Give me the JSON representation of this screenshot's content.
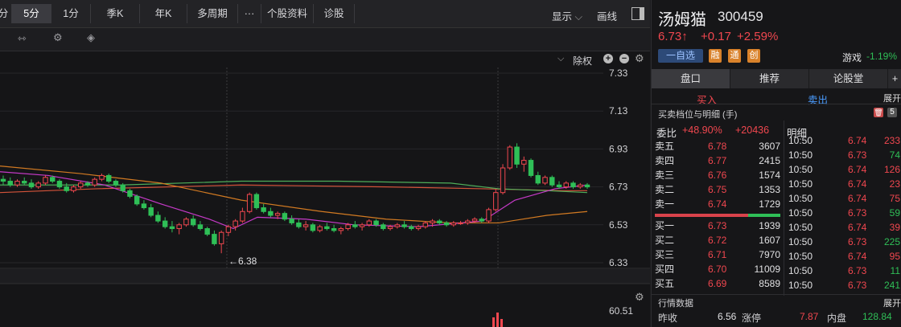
{
  "period_tabs": [
    "分",
    "5分",
    "1分",
    "季K",
    "年K",
    "多周期",
    "···",
    "个股资料",
    "诊股"
  ],
  "active_tab_index": 1,
  "display_label": "显示",
  "draw_label": "画线",
  "chart_header": {
    "adjust_label": "除权"
  },
  "price_axis": [
    "7.33",
    "7.13",
    "6.93",
    "6.73",
    "6.53",
    "6.33"
  ],
  "volume_axis_top": "60.51",
  "min_marker": "←6.38",
  "stock": {
    "name": "汤姆猫",
    "code": "300459",
    "price": "6.73↑",
    "change": "+0.17",
    "change_pct": "+2.59%",
    "watch_label": "一自选",
    "badges": [
      "融",
      "通",
      "创"
    ],
    "sector": "游戏",
    "sector_change": "-1.19%"
  },
  "right_tabs": [
    "盘口",
    "推荐",
    "论股堂",
    "+"
  ],
  "buy_label": "买入",
  "sell_label": "卖出",
  "expand_label": "展开",
  "orderbook_title": "买卖档位与明细 (手)",
  "orderbook_icon_label": "5",
  "weibi": {
    "label": "委比",
    "pct": "+48.90%",
    "value": "+20436"
  },
  "detail_label": "明细",
  "asks": [
    {
      "label": "卖五",
      "price": "6.78",
      "vol": "3607"
    },
    {
      "label": "卖四",
      "price": "6.77",
      "vol": "2415"
    },
    {
      "label": "卖三",
      "price": "6.76",
      "vol": "1574"
    },
    {
      "label": "卖二",
      "price": "6.75",
      "vol": "1353"
    },
    {
      "label": "卖一",
      "price": "6.74",
      "vol": "1729"
    }
  ],
  "bids": [
    {
      "label": "买一",
      "price": "6.73",
      "vol": "1939"
    },
    {
      "label": "买二",
      "price": "6.72",
      "vol": "1607"
    },
    {
      "label": "买三",
      "price": "6.71",
      "vol": "7970"
    },
    {
      "label": "买四",
      "price": "6.70",
      "vol": "11009"
    },
    {
      "label": "买五",
      "price": "6.69",
      "vol": "8589"
    }
  ],
  "ticks": [
    {
      "time": "10:50",
      "price": "6.74",
      "vol": "233",
      "dir": "up"
    },
    {
      "time": "10:50",
      "price": "6.73",
      "vol": "74",
      "dir": "down"
    },
    {
      "time": "10:50",
      "price": "6.74",
      "vol": "126",
      "dir": "up"
    },
    {
      "time": "10:50",
      "price": "6.74",
      "vol": "23",
      "dir": "up"
    },
    {
      "time": "10:50",
      "price": "6.74",
      "vol": "75",
      "dir": "up"
    },
    {
      "time": "10:50",
      "price": "6.73",
      "vol": "59",
      "dir": "down"
    },
    {
      "time": "10:50",
      "price": "6.74",
      "vol": "39",
      "dir": "up"
    },
    {
      "time": "10:50",
      "price": "6.73",
      "vol": "225",
      "dir": "down"
    },
    {
      "time": "10:50",
      "price": "6.74",
      "vol": "95",
      "dir": "up"
    },
    {
      "time": "10:50",
      "price": "6.73",
      "vol": "11",
      "dir": "down"
    },
    {
      "time": "10:50",
      "price": "6.73",
      "vol": "241",
      "dir": "down"
    }
  ],
  "market_title": "行情数据",
  "market_expand": "展开",
  "market": {
    "prev_close_label": "昨收",
    "prev_close": "6.56",
    "limit_up_label": "涨停",
    "limit_up": "7.87",
    "inner_label": "内盘",
    "inner": "128.84"
  },
  "colors": {
    "up": "#f0474f",
    "down": "#2fbf57",
    "accent": "#3a7bd5"
  },
  "candles": [
    {
      "o": 6.77,
      "h": 6.79,
      "l": 6.74,
      "c": 6.76
    },
    {
      "o": 6.76,
      "h": 6.78,
      "l": 6.73,
      "c": 6.74
    },
    {
      "o": 6.74,
      "h": 6.77,
      "l": 6.73,
      "c": 6.76
    },
    {
      "o": 6.76,
      "h": 6.78,
      "l": 6.74,
      "c": 6.75
    },
    {
      "o": 6.75,
      "h": 6.77,
      "l": 6.72,
      "c": 6.73
    },
    {
      "o": 6.73,
      "h": 6.76,
      "l": 6.72,
      "c": 6.75
    },
    {
      "o": 6.75,
      "h": 6.79,
      "l": 6.74,
      "c": 6.78
    },
    {
      "o": 6.78,
      "h": 6.79,
      "l": 6.75,
      "c": 6.76
    },
    {
      "o": 6.76,
      "h": 6.77,
      "l": 6.72,
      "c": 6.73
    },
    {
      "o": 6.73,
      "h": 6.75,
      "l": 6.7,
      "c": 6.71
    },
    {
      "o": 6.71,
      "h": 6.74,
      "l": 6.7,
      "c": 6.73
    },
    {
      "o": 6.73,
      "h": 6.76,
      "l": 6.72,
      "c": 6.75
    },
    {
      "o": 6.75,
      "h": 6.76,
      "l": 6.73,
      "c": 6.74
    },
    {
      "o": 6.74,
      "h": 6.78,
      "l": 6.73,
      "c": 6.77
    },
    {
      "o": 6.77,
      "h": 6.8,
      "l": 6.76,
      "c": 6.79
    },
    {
      "o": 6.79,
      "h": 6.8,
      "l": 6.75,
      "c": 6.76
    },
    {
      "o": 6.76,
      "h": 6.77,
      "l": 6.73,
      "c": 6.74
    },
    {
      "o": 6.74,
      "h": 6.75,
      "l": 6.7,
      "c": 6.71
    },
    {
      "o": 6.71,
      "h": 6.72,
      "l": 6.67,
      "c": 6.68
    },
    {
      "o": 6.68,
      "h": 6.69,
      "l": 6.63,
      "c": 6.64
    },
    {
      "o": 6.64,
      "h": 6.66,
      "l": 6.61,
      "c": 6.62
    },
    {
      "o": 6.62,
      "h": 6.64,
      "l": 6.57,
      "c": 6.58
    },
    {
      "o": 6.58,
      "h": 6.6,
      "l": 6.54,
      "c": 6.55
    },
    {
      "o": 6.55,
      "h": 6.57,
      "l": 6.51,
      "c": 6.52
    },
    {
      "o": 6.52,
      "h": 6.55,
      "l": 6.49,
      "c": 6.51
    },
    {
      "o": 6.51,
      "h": 6.54,
      "l": 6.48,
      "c": 6.53
    },
    {
      "o": 6.53,
      "h": 6.57,
      "l": 6.52,
      "c": 6.56
    },
    {
      "o": 6.56,
      "h": 6.58,
      "l": 6.52,
      "c": 6.53
    },
    {
      "o": 6.53,
      "h": 6.55,
      "l": 6.5,
      "c": 6.51
    },
    {
      "o": 6.51,
      "h": 6.52,
      "l": 6.47,
      "c": 6.48
    },
    {
      "o": 6.48,
      "h": 6.5,
      "l": 6.42,
      "c": 6.43
    },
    {
      "o": 6.43,
      "h": 6.5,
      "l": 6.38,
      "c": 6.49
    },
    {
      "o": 6.49,
      "h": 6.53,
      "l": 6.47,
      "c": 6.52
    },
    {
      "o": 6.52,
      "h": 6.56,
      "l": 6.5,
      "c": 6.55
    },
    {
      "o": 6.55,
      "h": 6.62,
      "l": 6.54,
      "c": 6.6
    },
    {
      "o": 6.6,
      "h": 6.7,
      "l": 6.59,
      "c": 6.69
    },
    {
      "o": 6.69,
      "h": 6.7,
      "l": 6.61,
      "c": 6.62
    },
    {
      "o": 6.62,
      "h": 6.64,
      "l": 6.59,
      "c": 6.6
    },
    {
      "o": 6.6,
      "h": 6.62,
      "l": 6.57,
      "c": 6.58
    },
    {
      "o": 6.58,
      "h": 6.6,
      "l": 6.56,
      "c": 6.59
    },
    {
      "o": 6.59,
      "h": 6.6,
      "l": 6.55,
      "c": 6.56
    },
    {
      "o": 6.56,
      "h": 6.58,
      "l": 6.53,
      "c": 6.54
    },
    {
      "o": 6.54,
      "h": 6.56,
      "l": 6.51,
      "c": 6.52
    },
    {
      "o": 6.52,
      "h": 6.55,
      "l": 6.5,
      "c": 6.53
    },
    {
      "o": 6.53,
      "h": 6.54,
      "l": 6.49,
      "c": 6.5
    },
    {
      "o": 6.5,
      "h": 6.53,
      "l": 6.49,
      "c": 6.52
    },
    {
      "o": 6.52,
      "h": 6.54,
      "l": 6.5,
      "c": 6.51
    },
    {
      "o": 6.51,
      "h": 6.53,
      "l": 6.49,
      "c": 6.5
    },
    {
      "o": 6.5,
      "h": 6.52,
      "l": 6.48,
      "c": 6.51
    },
    {
      "o": 6.51,
      "h": 6.54,
      "l": 6.5,
      "c": 6.53
    },
    {
      "o": 6.53,
      "h": 6.55,
      "l": 6.51,
      "c": 6.52
    },
    {
      "o": 6.52,
      "h": 6.54,
      "l": 6.5,
      "c": 6.53
    },
    {
      "o": 6.53,
      "h": 6.56,
      "l": 6.52,
      "c": 6.55
    },
    {
      "o": 6.55,
      "h": 6.56,
      "l": 6.52,
      "c": 6.53
    },
    {
      "o": 6.53,
      "h": 6.54,
      "l": 6.5,
      "c": 6.51
    },
    {
      "o": 6.51,
      "h": 6.53,
      "l": 6.5,
      "c": 6.52
    },
    {
      "o": 6.52,
      "h": 6.54,
      "l": 6.51,
      "c": 6.53
    },
    {
      "o": 6.53,
      "h": 6.55,
      "l": 6.51,
      "c": 6.52
    },
    {
      "o": 6.52,
      "h": 6.53,
      "l": 6.5,
      "c": 6.51
    },
    {
      "o": 6.51,
      "h": 6.53,
      "l": 6.5,
      "c": 6.52
    },
    {
      "o": 6.52,
      "h": 6.55,
      "l": 6.51,
      "c": 6.54
    },
    {
      "o": 6.54,
      "h": 6.56,
      "l": 6.52,
      "c": 6.55
    },
    {
      "o": 6.55,
      "h": 6.56,
      "l": 6.53,
      "c": 6.54
    },
    {
      "o": 6.54,
      "h": 6.55,
      "l": 6.52,
      "c": 6.53
    },
    {
      "o": 6.53,
      "h": 6.55,
      "l": 6.52,
      "c": 6.54
    },
    {
      "o": 6.54,
      "h": 6.55,
      "l": 6.53,
      "c": 6.54
    },
    {
      "o": 6.54,
      "h": 6.56,
      "l": 6.53,
      "c": 6.55
    },
    {
      "o": 6.55,
      "h": 6.57,
      "l": 6.54,
      "c": 6.56
    },
    {
      "o": 6.56,
      "h": 6.57,
      "l": 6.54,
      "c": 6.55
    },
    {
      "o": 6.55,
      "h": 6.62,
      "l": 6.54,
      "c": 6.61
    },
    {
      "o": 6.61,
      "h": 6.72,
      "l": 6.6,
      "c": 6.7
    },
    {
      "o": 6.7,
      "h": 6.85,
      "l": 6.69,
      "c": 6.83
    },
    {
      "o": 6.83,
      "h": 6.95,
      "l": 6.82,
      "c": 6.94
    },
    {
      "o": 6.94,
      "h": 6.96,
      "l": 6.83,
      "c": 6.85
    },
    {
      "o": 6.85,
      "h": 6.89,
      "l": 6.81,
      "c": 6.87
    },
    {
      "o": 6.87,
      "h": 6.88,
      "l": 6.78,
      "c": 6.79
    },
    {
      "o": 6.79,
      "h": 6.81,
      "l": 6.74,
      "c": 6.75
    },
    {
      "o": 6.75,
      "h": 6.79,
      "l": 6.74,
      "c": 6.78
    },
    {
      "o": 6.78,
      "h": 6.79,
      "l": 6.73,
      "c": 6.74
    },
    {
      "o": 6.74,
      "h": 6.76,
      "l": 6.72,
      "c": 6.73
    },
    {
      "o": 6.73,
      "h": 6.76,
      "l": 6.72,
      "c": 6.75
    },
    {
      "o": 6.75,
      "h": 6.76,
      "l": 6.72,
      "c": 6.73
    },
    {
      "o": 6.73,
      "h": 6.75,
      "l": 6.72,
      "c": 6.74
    },
    {
      "o": 6.74,
      "h": 6.75,
      "l": 6.72,
      "c": 6.73
    }
  ]
}
